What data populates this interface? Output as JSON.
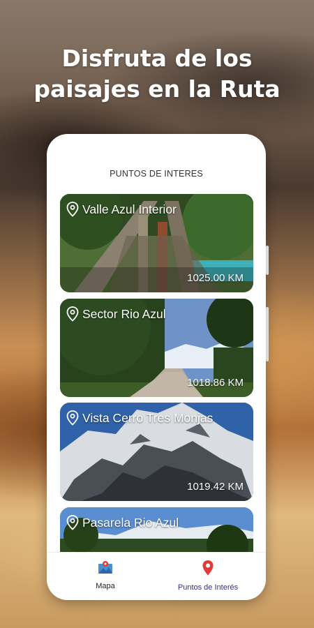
{
  "headline": {
    "line1": "Disfruta de los",
    "line2": "paisajes en la Ruta"
  },
  "screen": {
    "title": "PUNTOS DE INTERES"
  },
  "points": [
    {
      "name": "Valle Azul Interior",
      "distance": "1025.00 KM",
      "icon": "location-pin-icon"
    },
    {
      "name": "Sector Rio Azul",
      "distance": "1018.86 KM",
      "icon": "location-pin-icon"
    },
    {
      "name": "Vista Cerro Tres Monjas",
      "distance": "1019.42 KM",
      "icon": "location-pin-icon"
    },
    {
      "name": "Pasarela Rio Azul",
      "distance": "",
      "icon": "location-pin-icon"
    }
  ],
  "nav": {
    "items": [
      {
        "label": "Mapa",
        "icon": "map-icon",
        "active": false
      },
      {
        "label": "Puntos de Interés",
        "icon": "map-pin-icon",
        "active": true
      }
    ],
    "colors": {
      "active_label": "#3a2a8c",
      "inactive_label": "#222222",
      "pin": "#e53935",
      "map_icon": "#4a8fd0"
    }
  }
}
